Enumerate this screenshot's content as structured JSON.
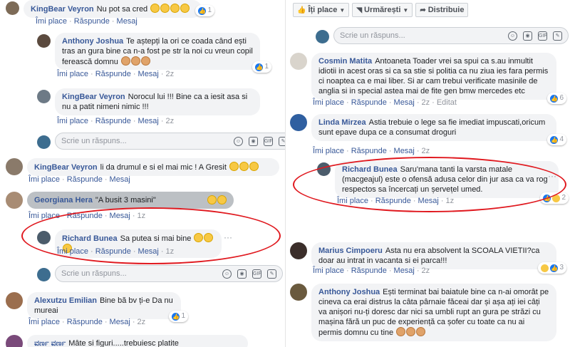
{
  "left": {
    "c1": {
      "name": "KingBear Veyron",
      "text": "Nu pot sa cred",
      "react": "1"
    },
    "c2": {
      "name": "Anthony Joshua",
      "text": "Te aștepți la ori ce coada când ești tras an gura bine ca n-a fost pe str la noi cu vreun copil ferească domnu",
      "react": "1",
      "age": "2z"
    },
    "c3": {
      "name": "KingBear Veyron",
      "text": "Norocul lui !!! Bine ca a iesit asa si nu a patit nimeni nimic !!!",
      "age": "2z"
    },
    "r1": {
      "placeholder": "Scrie un răspuns..."
    },
    "c4": {
      "name": "KingBear Veyron",
      "text": "li da drumul e si el mai mic ! A Gresit"
    },
    "c5": {
      "name": "Georgiana Hera",
      "text": "\"A busit 3 masini\"",
      "age": "1z"
    },
    "c6": {
      "name": "Richard Bunea",
      "text": "Sa putea si mai bine",
      "age": "1z"
    },
    "r2": {
      "placeholder": "Scrie un răspuns..."
    },
    "c7": {
      "name": "Alexutzu Emilian",
      "text": "Bine bă bv ți-e Da nu mureai",
      "react": "1",
      "age": "2z"
    },
    "c8": {
      "name": "ವರ್ಣ ವರ್ಣ",
      "text": "Mâte si figuri.....trebuiesc platite"
    }
  },
  "right": {
    "toolbar": {
      "like": "Îți place",
      "follow": "Urmărești",
      "share": "Distribuie"
    },
    "r0": {
      "placeholder": "Scrie un răspuns..."
    },
    "c1": {
      "name": "Cosmin Matita",
      "text": "Antoaneta Toader vrei sa spui ca s.au inmultit idiotii in acest oras si ca sa stie si politia ca nu ziua ies fara permis ci noaptea ca e mai liber. Si ar cam trebui verificate masinile de anglia si in special astea mai de fite gen bmw mercedes etc",
      "react": "6",
      "age": "2z",
      "edited": "Editat"
    },
    "c2": {
      "name": "Linda Mirzea",
      "text": "Astia trebuie o lege sa fie imediat impuscati,oricum sunt epave dupa ce a consumat droguri",
      "react": "4",
      "age": "2z"
    },
    "c3": {
      "name": "Richard Bunea",
      "text": "Saru'mana tanti la varsta matale (macgeajul) este o ofensă adusa celor din jur asa ca va rog respectos sa încercați un șervețel umed.",
      "react": "2",
      "age": "1z"
    },
    "c4": {
      "name": "Marius Cimpoeru",
      "text": "Asta nu era absolvent la SCOALA VIETII?ca doar au intrat in vacanta si ei parca!!!",
      "react": "3",
      "age": "2z"
    },
    "c5": {
      "name": "Anthony Joshua",
      "text": "Ești terminat bai baiatule bine ca n-ai omorât pe cineva ca erai distrus la câta pârnaie făceai dar și așa ați iei câți va anișori nu-ți doresc dar nici sa umbli rupt an gura pe străzi cu mașina fără un puc de experiență ca șofer cu toate ca nu ai permis domnu cu tine"
    }
  },
  "meta": {
    "like": "Îmi place",
    "reply": "Răspunde",
    "message": "Mesaj"
  },
  "tools": {
    "gif": "GIF"
  },
  "colors": {
    "link": "#385898",
    "ring": "#e0191f",
    "like": "#1877f2"
  }
}
